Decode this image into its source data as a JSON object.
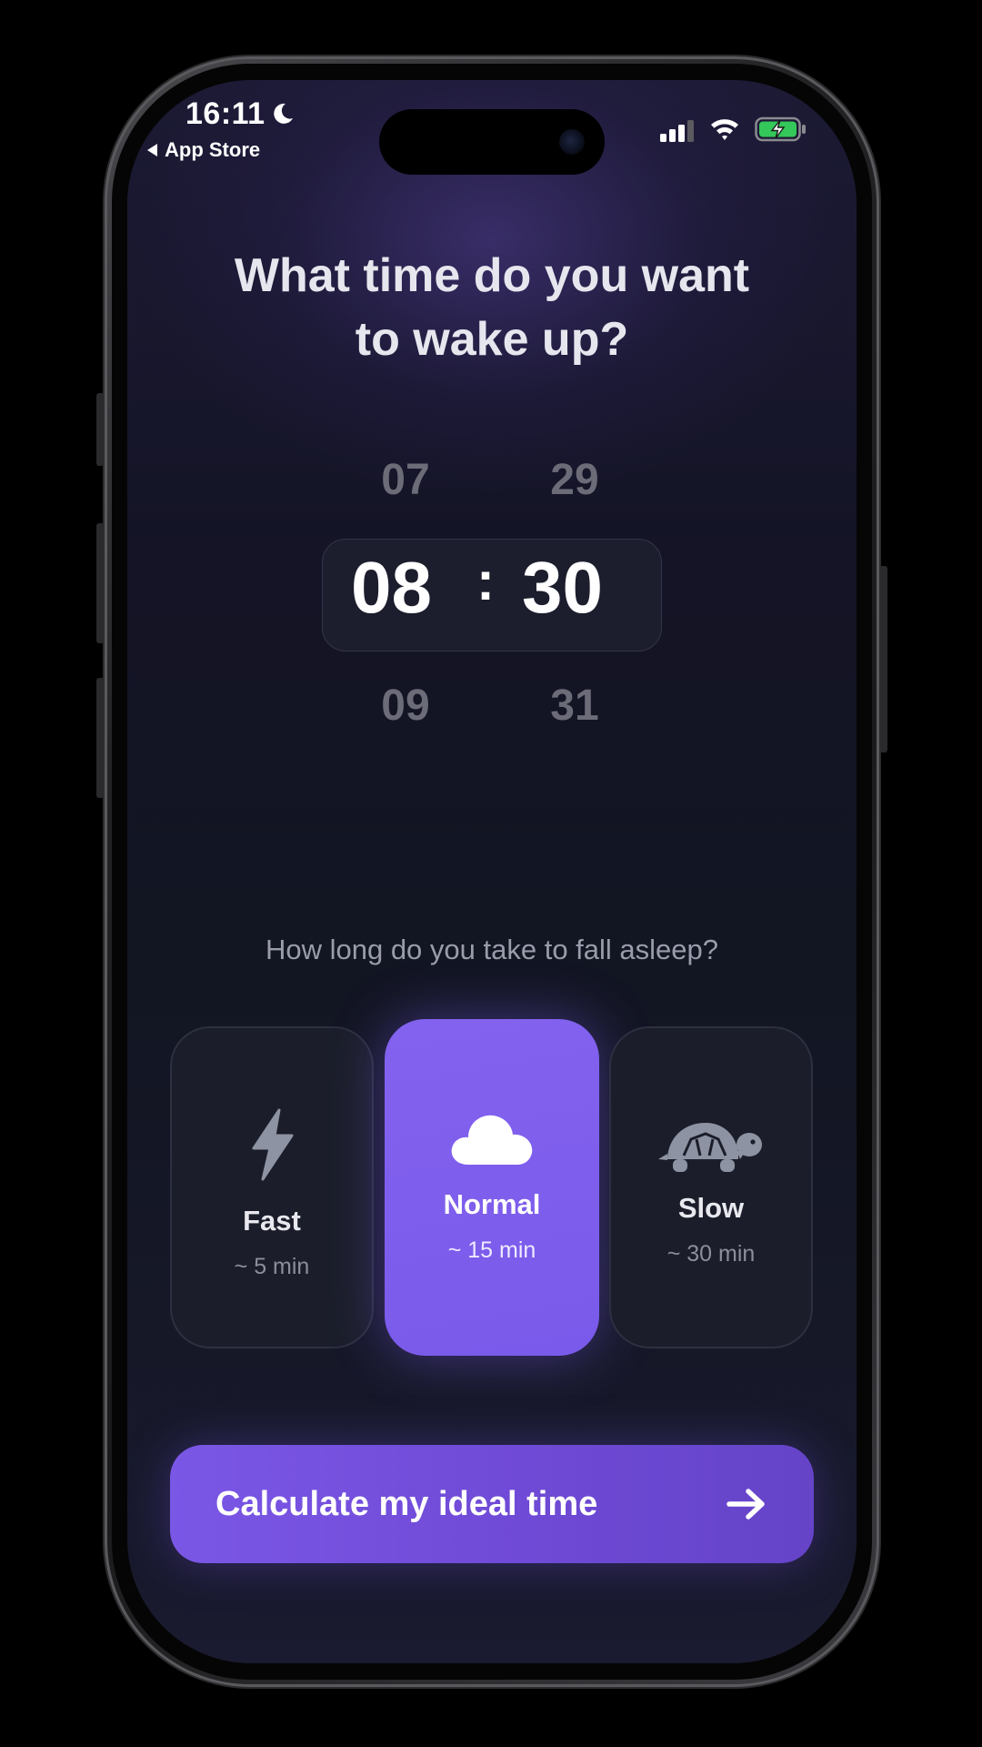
{
  "status_bar": {
    "time": "16:11",
    "back_label": "App Store"
  },
  "heading": {
    "line1": "What time do you want",
    "line2": "to wake up?"
  },
  "time_picker": {
    "hour_prev": "07",
    "hour_selected": "08",
    "hour_next": "09",
    "minute_prev": "29",
    "minute_selected": "30",
    "minute_next": "31",
    "separator": ":"
  },
  "sleep_speed": {
    "question": "How long do you take to fall asleep?",
    "options": [
      {
        "title": "Fast",
        "subtitle": "~ 5 min",
        "icon": "lightning-icon",
        "selected": false
      },
      {
        "title": "Normal",
        "subtitle": "~ 15 min",
        "icon": "cloud-icon",
        "selected": true
      },
      {
        "title": "Slow",
        "subtitle": "~ 30 min",
        "icon": "turtle-icon",
        "selected": false
      }
    ]
  },
  "cta": {
    "label": "Calculate my ideal time",
    "icon": "arrow-right-icon"
  },
  "colors": {
    "accent": "#7B5CEB",
    "background": "#141624",
    "card": "#1B1E2A",
    "muted_text": "#9A9CAB",
    "battery_green": "#34C759"
  }
}
